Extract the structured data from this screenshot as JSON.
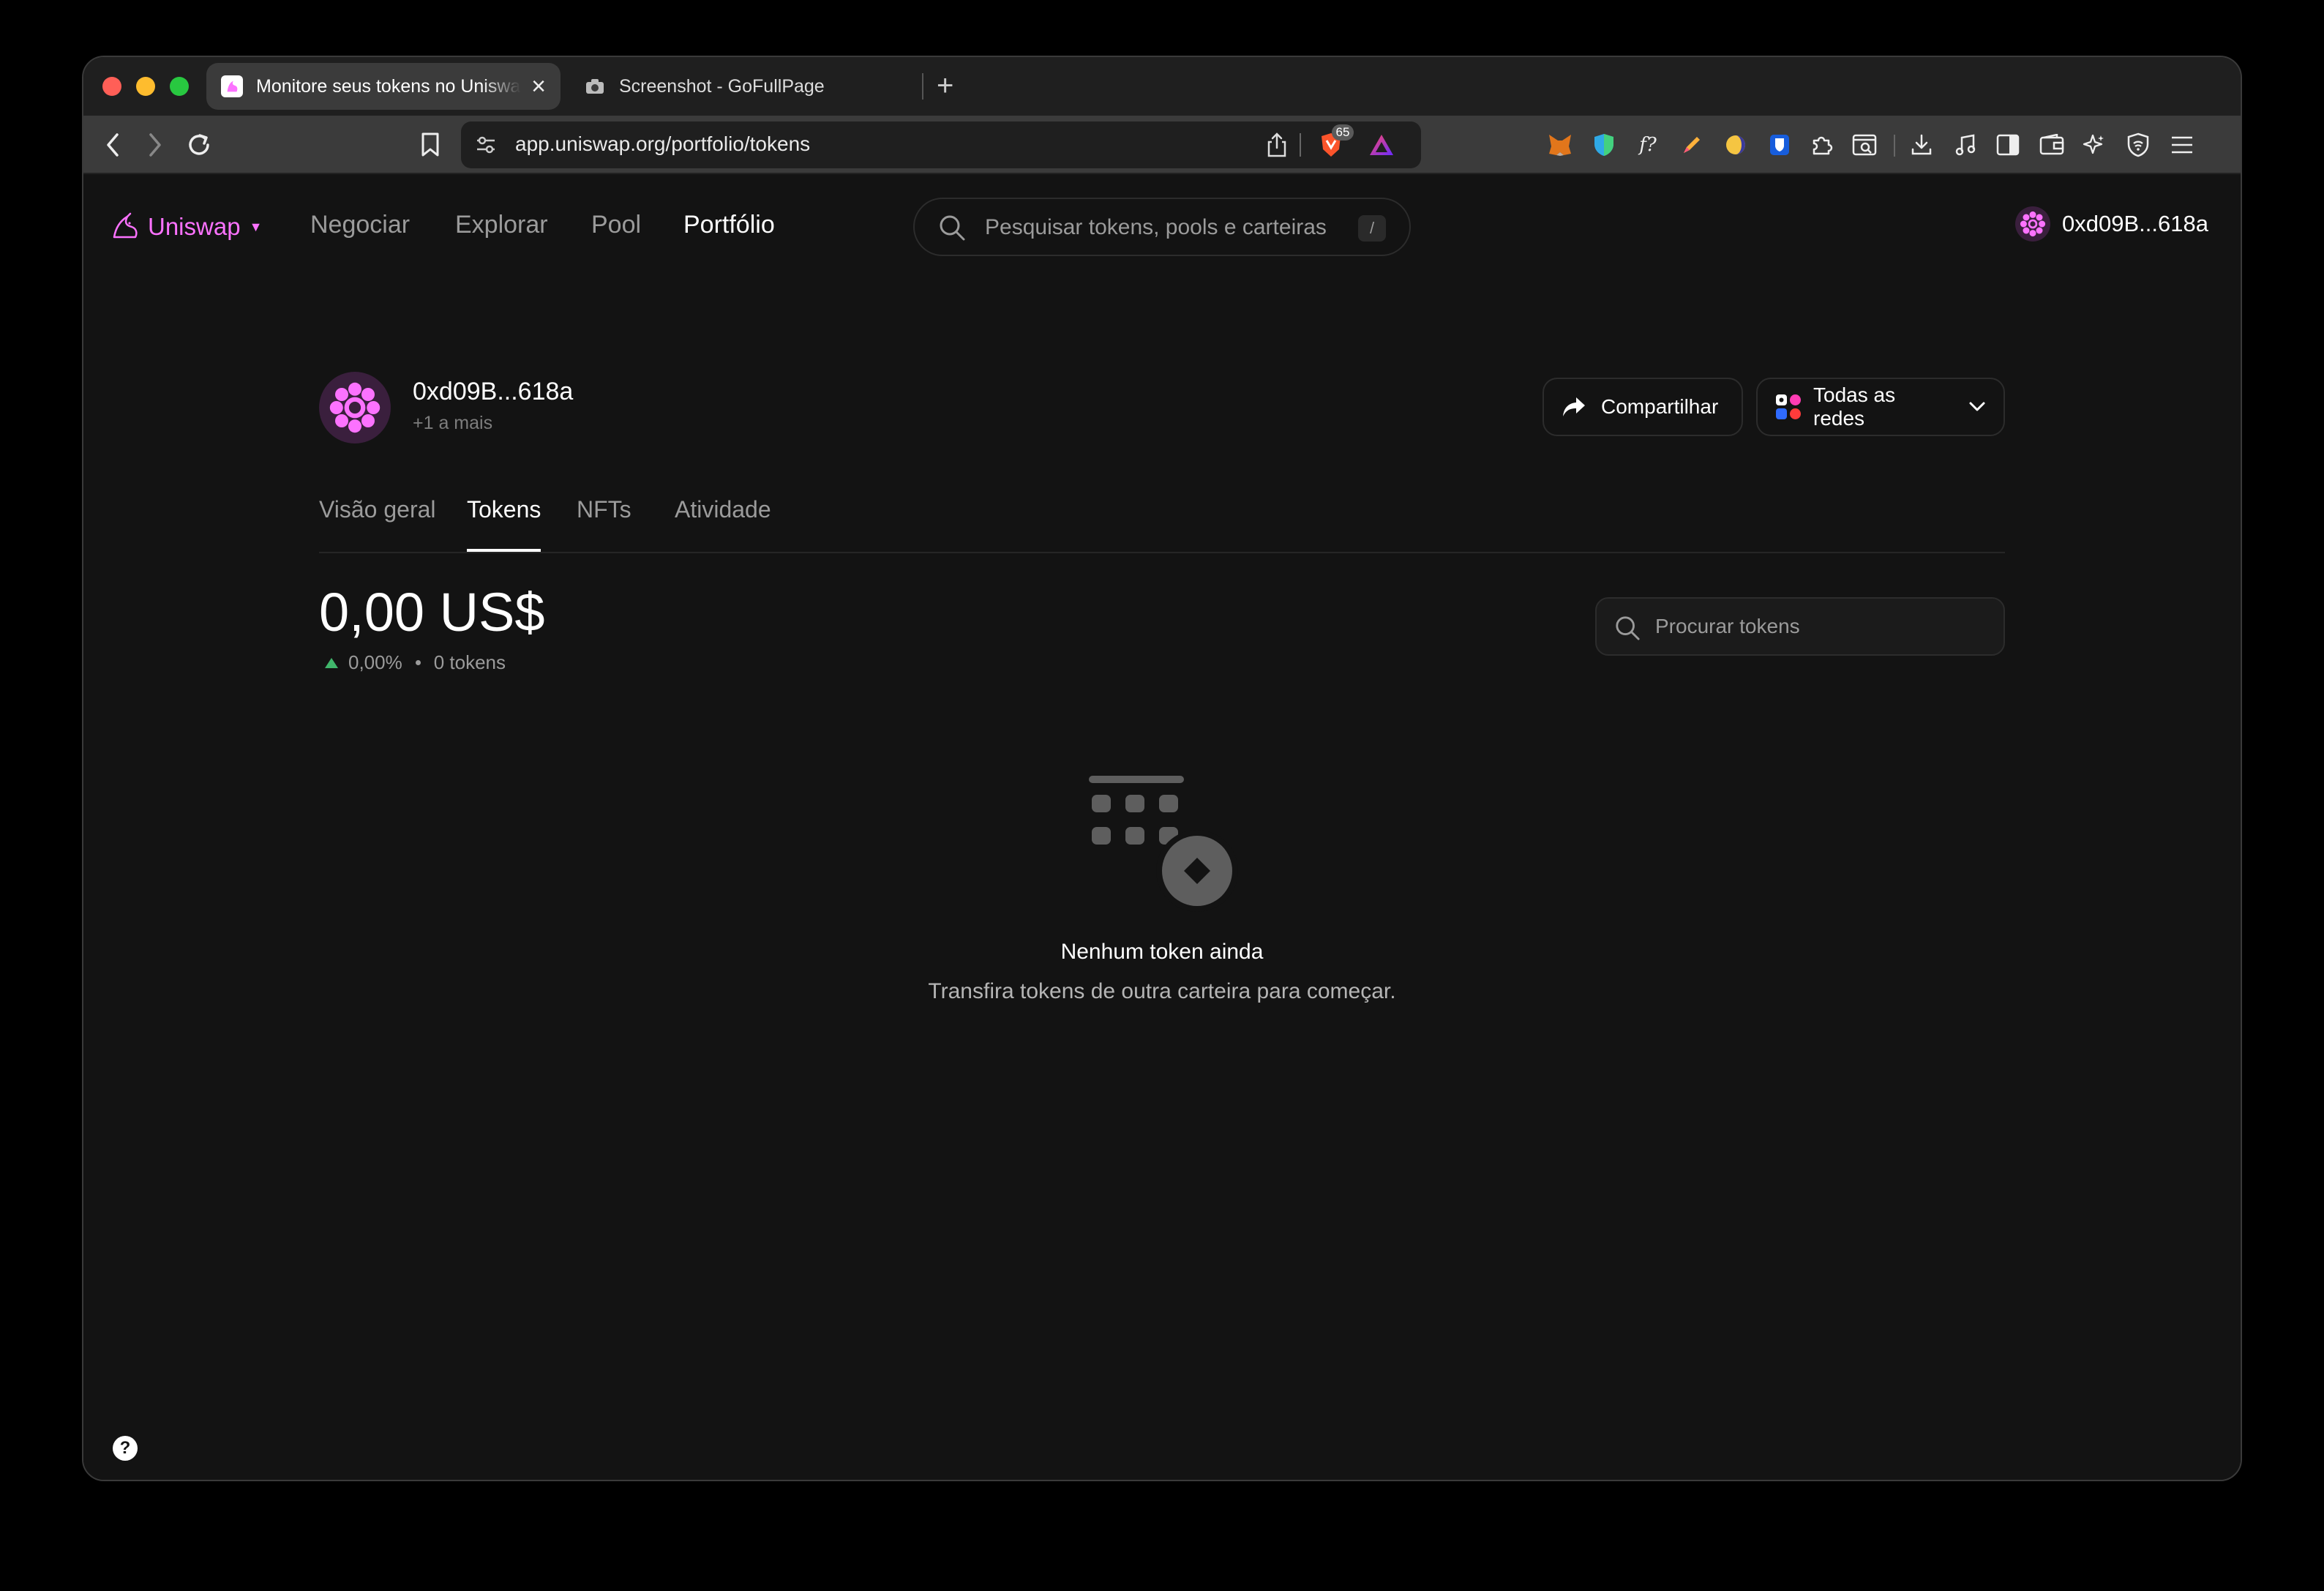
{
  "browser": {
    "tabs": [
      {
        "title": "Monitore seus tokens no Uniswap",
        "active": true
      },
      {
        "title": "Screenshot - GoFullPage",
        "active": false
      }
    ],
    "url": "app.uniswap.org/portfolio/tokens",
    "brave_shield_count": "65"
  },
  "nav": {
    "brand": "Uniswap",
    "items": [
      {
        "label": "Negociar",
        "active": false
      },
      {
        "label": "Explorar",
        "active": false
      },
      {
        "label": "Pool",
        "active": false
      },
      {
        "label": "Portfólio",
        "active": true
      }
    ],
    "search_placeholder": "Pesquisar tokens, pools e carteiras",
    "search_shortcut": "/",
    "account": "0xd09B...618a"
  },
  "profile": {
    "address": "0xd09B...618a",
    "subtitle": "+1 a mais",
    "share_label": "Compartilhar",
    "networks_label": "Todas as redes"
  },
  "tabs": [
    {
      "label": "Visão geral",
      "active": false
    },
    {
      "label": "Tokens",
      "active": true
    },
    {
      "label": "NFTs",
      "active": false
    },
    {
      "label": "Atividade",
      "active": false
    }
  ],
  "portfolio": {
    "balance": "0,00 US$",
    "change": "0,00%",
    "token_count": "0 tokens",
    "token_search_placeholder": "Procurar tokens"
  },
  "empty_state": {
    "title": "Nenhum token ainda",
    "description": "Transfira tokens de outra carteira para começar."
  },
  "help": "?",
  "colors": {
    "brand": "#fc72ff",
    "background": "#131313",
    "positive": "#40b66b"
  }
}
